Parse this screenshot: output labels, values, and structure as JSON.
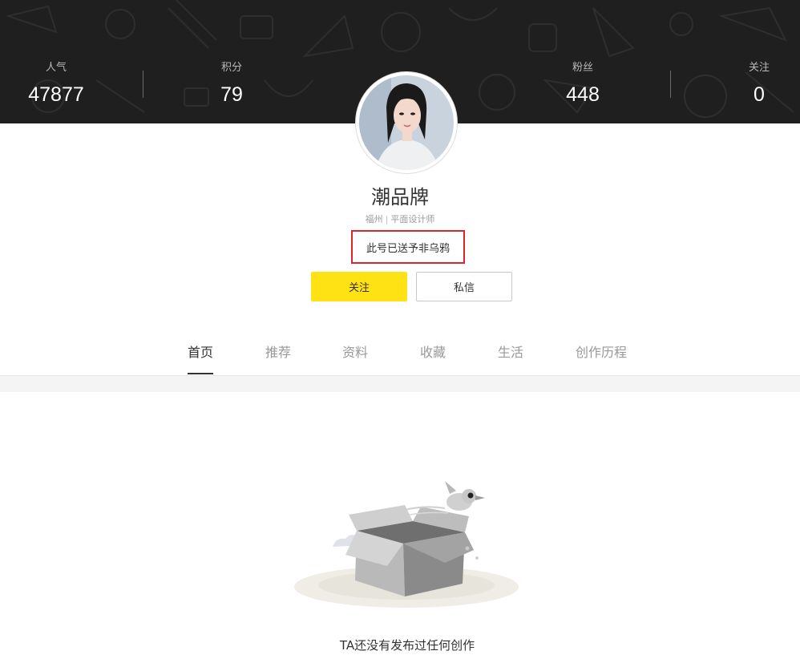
{
  "stats": {
    "popularity": {
      "label": "人气",
      "value": "47877"
    },
    "points": {
      "label": "积分",
      "value": "79"
    },
    "fans": {
      "label": "粉丝",
      "value": "448"
    },
    "following": {
      "label": "关注",
      "value": "0"
    }
  },
  "profile": {
    "name": "潮品牌",
    "city": "福州",
    "separator": "|",
    "occupation": "平面设计师",
    "intro": "此号已送予非乌鸦"
  },
  "actions": {
    "follow_label": "关注",
    "message_label": "私信"
  },
  "tabs": [
    {
      "label": "首页"
    },
    {
      "label": "推荐"
    },
    {
      "label": "资料"
    },
    {
      "label": "收藏"
    },
    {
      "label": "生活"
    },
    {
      "label": "创作历程"
    }
  ],
  "empty_state": {
    "message": "TA还没有发布过任何创作"
  },
  "colors": {
    "banner": "#1f1f1f",
    "accent_yellow": "#ffe214",
    "highlight_red": "#d9252c"
  },
  "icons": {
    "empty_illustration": "open-box-with-bird"
  }
}
